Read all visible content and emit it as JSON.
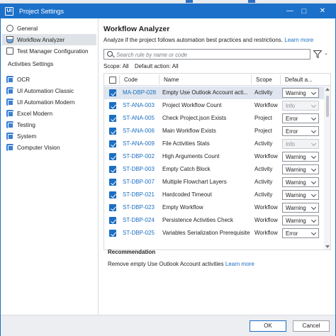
{
  "window": {
    "title": "Project Settings",
    "app_icon": "Ui",
    "minimize": "—",
    "maximize": "□",
    "close": "✕"
  },
  "sidebar": {
    "top_items": [
      {
        "label": "General",
        "icon": "gear-icon"
      },
      {
        "label": "Workflow Analyzer",
        "icon": "flask-icon"
      },
      {
        "label": "Test Manager Configuration",
        "icon": "test-manager-icon"
      }
    ],
    "section_label": "Activities Settings",
    "activity_items": [
      {
        "label": "OCR",
        "icon": "activity-icon"
      },
      {
        "label": "UI Automation Classic",
        "icon": "activity-icon"
      },
      {
        "label": "UI Automation Modern",
        "icon": "activity-icon"
      },
      {
        "label": "Excel Modern",
        "icon": "activity-icon"
      },
      {
        "label": "Testing",
        "icon": "activity-icon"
      },
      {
        "label": "System",
        "icon": "activity-icon"
      },
      {
        "label": "Computer Vision",
        "icon": "activity-icon"
      }
    ],
    "selected": "Workflow Analyzer"
  },
  "main": {
    "heading": "Workflow Analyzer",
    "description": "Analyze if the project follows automation best practices and restrictions.",
    "learn_more": "Learn more",
    "search_placeholder": "Search rule by name or code",
    "scope_text": "Scope: All",
    "default_action_text": "Default action: All",
    "columns": {
      "code": "Code",
      "name": "Name",
      "scope": "Scope",
      "default_action": "Default a..."
    },
    "rows": [
      {
        "code": "MA-DBP-028",
        "name": "Empty Use Outlook Account acti...",
        "scope": "Activity",
        "action": "Warning",
        "enabled": true,
        "selected": true
      },
      {
        "code": "ST-ANA-003",
        "name": "Project Workflow Count",
        "scope": "Workflow",
        "action": "Info",
        "enabled": false,
        "selected": false
      },
      {
        "code": "ST-ANA-005",
        "name": "Check Project.json Exists",
        "scope": "Project",
        "action": "Error",
        "enabled": true,
        "selected": false
      },
      {
        "code": "ST-ANA-006",
        "name": "Main Workflow Exists",
        "scope": "Project",
        "action": "Error",
        "enabled": true,
        "selected": false
      },
      {
        "code": "ST-ANA-009",
        "name": "File Activities Stats",
        "scope": "Activity",
        "action": "Info",
        "enabled": false,
        "selected": false
      },
      {
        "code": "ST-DBP-002",
        "name": "High Arguments Count",
        "scope": "Workflow",
        "action": "Warning",
        "enabled": true,
        "selected": false
      },
      {
        "code": "ST-DBP-003",
        "name": "Empty Catch Block",
        "scope": "Activity",
        "action": "Warning",
        "enabled": true,
        "selected": false
      },
      {
        "code": "ST-DBP-007",
        "name": "Multiple Flowchart Layers",
        "scope": "Activity",
        "action": "Warning",
        "enabled": true,
        "selected": false
      },
      {
        "code": "ST-DBP-021",
        "name": "Hardcoded Timeout",
        "scope": "Activity",
        "action": "Warning",
        "enabled": true,
        "selected": false
      },
      {
        "code": "ST-DBP-023",
        "name": "Empty Workflow",
        "scope": "Workflow",
        "action": "Warning",
        "enabled": true,
        "selected": false
      },
      {
        "code": "ST-DBP-024",
        "name": "Persistence Activities Check",
        "scope": "Workflow",
        "action": "Warning",
        "enabled": true,
        "selected": false
      },
      {
        "code": "ST-DBP-025",
        "name": "Variables Serialization Prerequisite",
        "scope": "Workflow",
        "action": "Error",
        "enabled": true,
        "selected": false
      }
    ],
    "recommendation_title": "Recommendation",
    "recommendation_text": "Remove empty Use Outlook Account activities",
    "recommendation_link": "Learn more"
  },
  "footer": {
    "ok": "OK",
    "cancel": "Cancel"
  },
  "colors": {
    "accent": "#1b70c9",
    "link": "#1b6ec2",
    "selected_row": "#dfe6ef"
  }
}
